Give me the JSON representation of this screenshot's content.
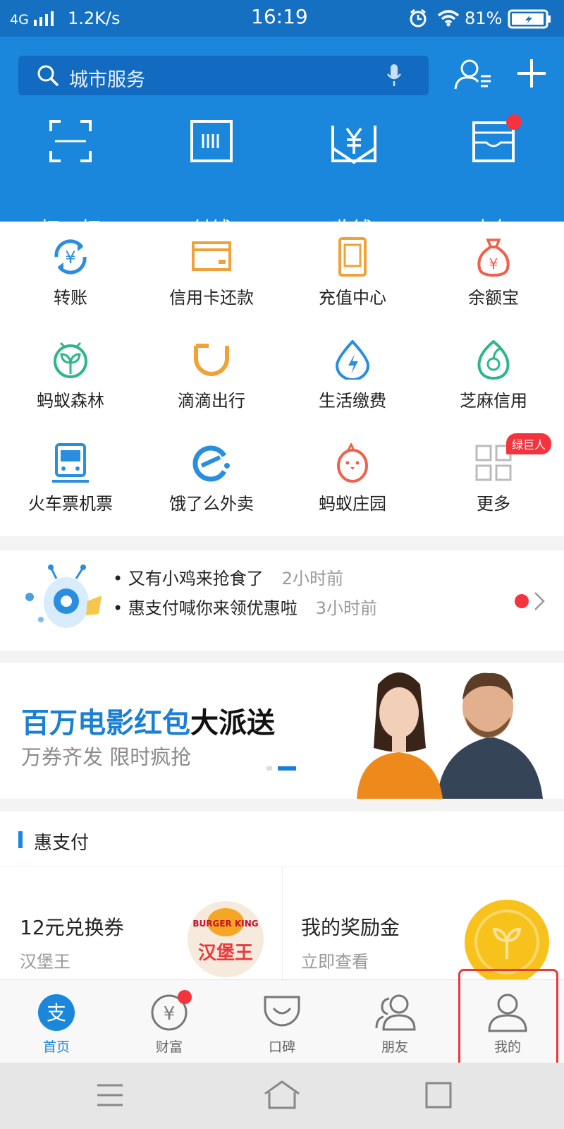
{
  "status_bar": {
    "network": "4G",
    "speed": "1.2K/s",
    "time": "16:19",
    "battery": "81%"
  },
  "search": {
    "placeholder": "城市服务",
    "icon": "search-icon",
    "voice_icon": "microphone-icon"
  },
  "header_actions": [
    "contacts-icon",
    "plus-icon"
  ],
  "quick_actions": [
    {
      "label": "扫一扫",
      "icon": "scan-icon"
    },
    {
      "label": "付钱",
      "icon": "pay-code-icon"
    },
    {
      "label": "收钱",
      "icon": "receive-money-icon"
    },
    {
      "label": "卡包",
      "icon": "card-wallet-icon"
    }
  ],
  "apps": [
    {
      "label": "转账",
      "icon": "transfer-icon",
      "color": "#2a8ee0"
    },
    {
      "label": "信用卡还款",
      "icon": "credit-card-icon",
      "color": "#f0a23a"
    },
    {
      "label": "充值中心",
      "icon": "phone-recharge-icon",
      "color": "#f0a23a"
    },
    {
      "label": "余额宝",
      "icon": "money-bag-icon",
      "color": "#f0604a"
    },
    {
      "label": "蚂蚁森林",
      "icon": "sprout-icon",
      "color": "#2fb58a"
    },
    {
      "label": "滴滴出行",
      "icon": "didi-icon",
      "color": "#f0a23a"
    },
    {
      "label": "生活缴费",
      "icon": "utility-drop-icon",
      "color": "#2a8ee0"
    },
    {
      "label": "芝麻信用",
      "icon": "sesame-icon",
      "color": "#2fb58a"
    },
    {
      "label": "火车票机票",
      "icon": "train-icon",
      "color": "#2a8ee0"
    },
    {
      "label": "饿了么外卖",
      "icon": "eleme-icon",
      "color": "#2a8ee0"
    },
    {
      "label": "蚂蚁庄园",
      "icon": "chick-icon",
      "color": "#f0604a"
    },
    {
      "label": "更多",
      "icon": "grid-more-icon",
      "color": "#bbbbbb"
    }
  ],
  "more_badge": "绿巨人",
  "notices": [
    {
      "text": "又有小鸡来抢食了",
      "time": "2小时前"
    },
    {
      "text": "惠支付喊你来领优惠啦",
      "time": "3小时前"
    }
  ],
  "banner": {
    "title_highlight": "百万电影红包",
    "title_rest": "大派送",
    "subtitle": "万券齐发 限时疯抢"
  },
  "hui": {
    "title": "惠支付",
    "cards": [
      {
        "title": "12元兑换券",
        "subtitle": "汉堡王",
        "logo_text": "BURGER KING",
        "logo_cn": "汉堡王"
      },
      {
        "title": "我的奖励金",
        "subtitle": "立即查看"
      }
    ]
  },
  "tabs": [
    {
      "label": "首页",
      "icon": "alipay-home-icon",
      "active": true
    },
    {
      "label": "财富",
      "icon": "wealth-icon",
      "active": false
    },
    {
      "label": "口碑",
      "icon": "koubei-icon",
      "active": false
    },
    {
      "label": "朋友",
      "icon": "friends-icon",
      "active": false
    },
    {
      "label": "我的",
      "icon": "profile-icon",
      "active": false
    }
  ],
  "colors": {
    "brand_blue": "#1a86dc",
    "status_blue": "#1670c2",
    "highlight_red": "#e8393c",
    "banner_blue": "#1a7fd6"
  }
}
